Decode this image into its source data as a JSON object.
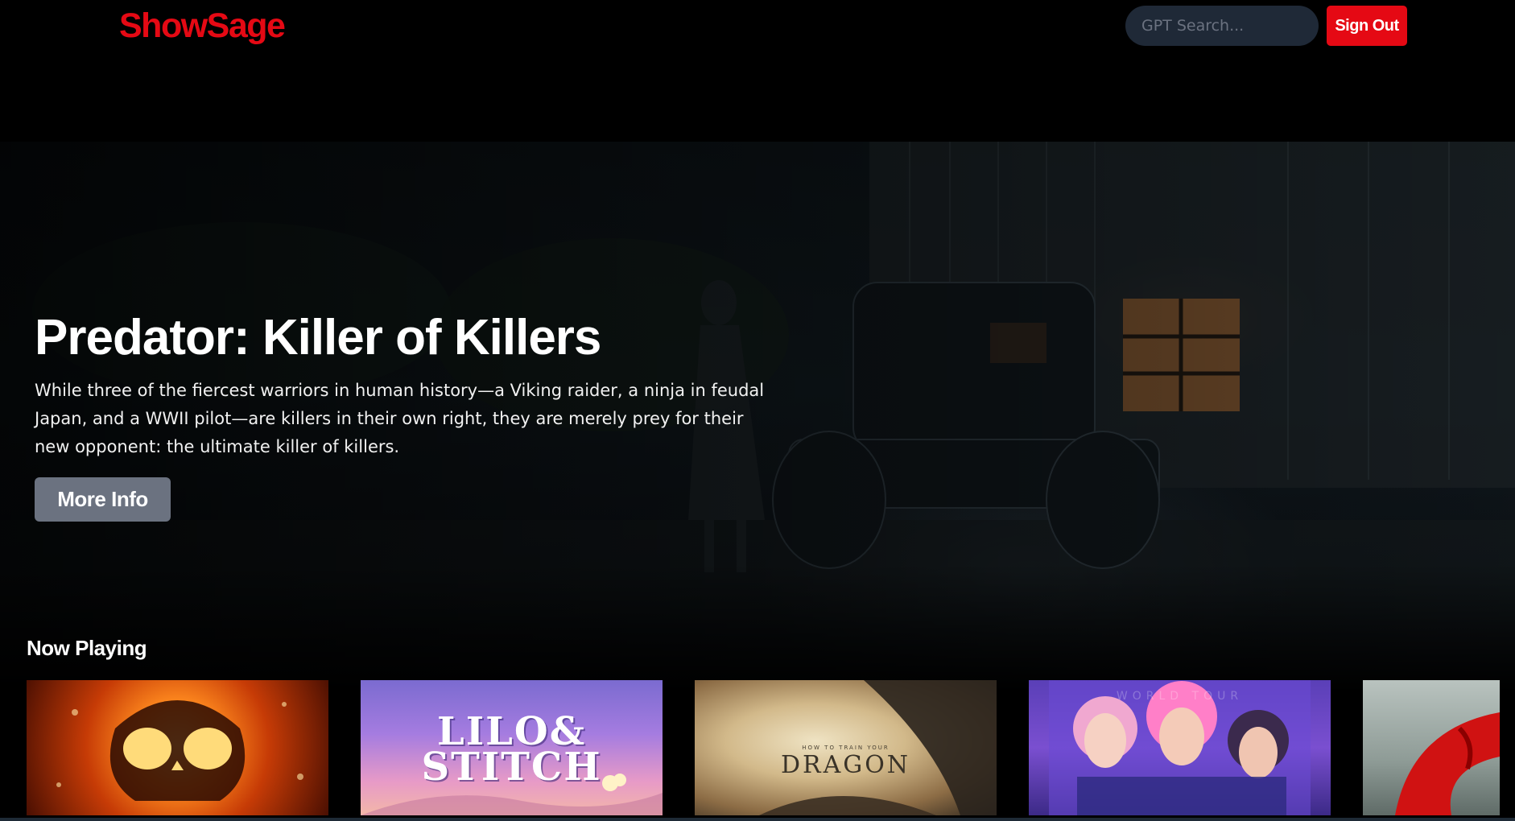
{
  "header": {
    "logo": "ShowSage",
    "search_placeholder": "GPT Search...",
    "sign_out_label": "Sign Out"
  },
  "hero": {
    "title": "Predator: Killer of Killers",
    "description": "While three of the fiercest warriors in human history—a Viking raider, a ninja in feudal Japan, and a WWII pilot—are killers in their own right, they are merely prey for their new opponent: the ultimate killer of killers.",
    "more_info_label": "More Info"
  },
  "now_playing": {
    "title": "Now Playing",
    "posters": [
      {
        "icon": "flaming-skull"
      },
      {
        "title": "LILO&\nSTITCH"
      },
      {
        "subtitle": "HOW TO TRAIN YOUR",
        "title": "DRAGON"
      },
      {
        "text_top": "WORLD TOUR"
      },
      {
        "icon": "red-swirl"
      }
    ]
  },
  "colors": {
    "brand": "#e50914",
    "search_bg": "#1f2937",
    "more_info_bg": "#6b7280"
  }
}
